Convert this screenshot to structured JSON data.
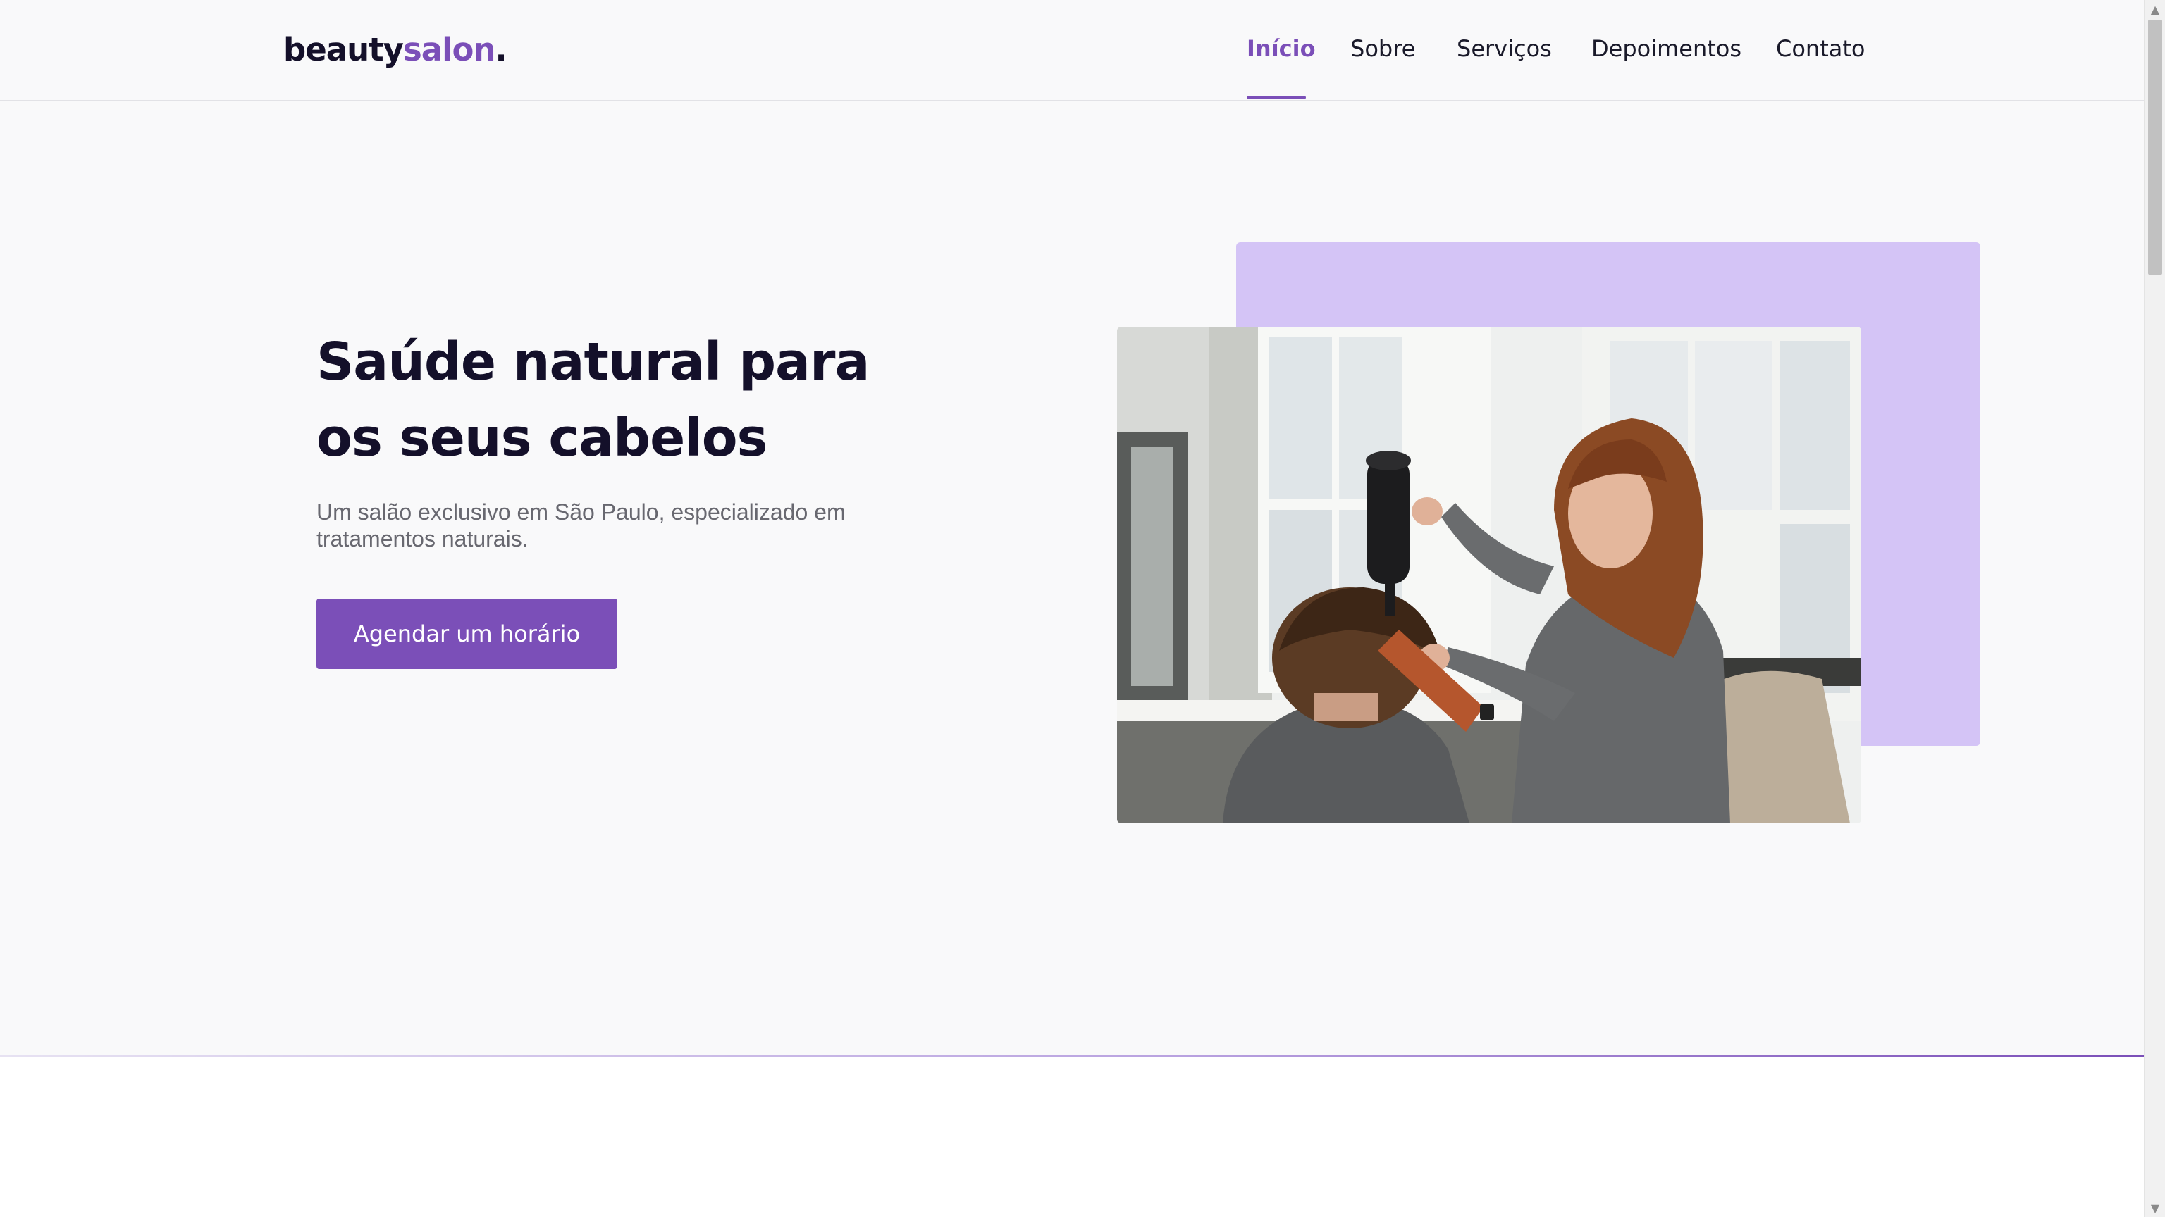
{
  "brand": {
    "name_part1": "beauty",
    "name_part2": "salon",
    "dot": "."
  },
  "nav": {
    "items": [
      {
        "label": "Início",
        "active": true
      },
      {
        "label": "Sobre"
      },
      {
        "label": "Serviços"
      },
      {
        "label": "Depoimentos"
      },
      {
        "label": "Contato"
      }
    ]
  },
  "hero": {
    "title_line1": "Saúde natural para",
    "title_line2": "os seus cabelos",
    "subtitle": "Um salão exclusivo em São Paulo, especializado em tratamentos naturais.",
    "cta_label": "Agendar um horário",
    "image_icon": "hairdresser-photo"
  },
  "colors": {
    "accent": "#7b4fb8",
    "accent_light": "#d4c4f6",
    "heading": "#14102a",
    "body_text": "#686870",
    "background": "#f9f9fa"
  }
}
